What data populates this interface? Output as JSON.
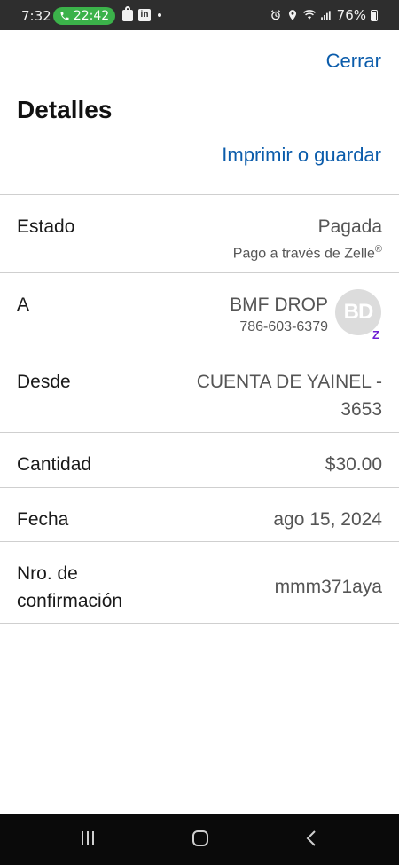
{
  "status_bar": {
    "time": "7:32",
    "call_timer": "22:42",
    "battery": "76%",
    "icons": [
      "phone-icon",
      "shopping-bag-icon",
      "linkedin-icon",
      "alarm-icon",
      "location-icon",
      "wifi-icon",
      "signal-icon",
      "battery-icon"
    ]
  },
  "header": {
    "close_label": "Cerrar",
    "title": "Detalles",
    "print_label": "Imprimir o guardar"
  },
  "details": {
    "estado": {
      "label": "Estado",
      "value": "Pagada",
      "sub_prefix": "Pago a través de Zelle",
      "sub_mark": "®"
    },
    "a": {
      "label": "A",
      "name": "BMF DROP",
      "phone": "786-603-6379",
      "avatar_initials": "BD",
      "badge": "Z"
    },
    "desde": {
      "label": "Desde",
      "value_line1": "CUENTA DE YAINEL -",
      "value_line2": "3653"
    },
    "cantidad": {
      "label": "Cantidad",
      "value": "$30.00"
    },
    "fecha": {
      "label": "Fecha",
      "value": "ago 15, 2024"
    },
    "confirmacion": {
      "label_line1": "Nro. de",
      "label_line2": "confirmación",
      "value": "mmm371aya"
    }
  },
  "colors": {
    "link": "#0b5cab",
    "call_pill": "#3bb24a",
    "zelle": "#6d1ed4"
  }
}
